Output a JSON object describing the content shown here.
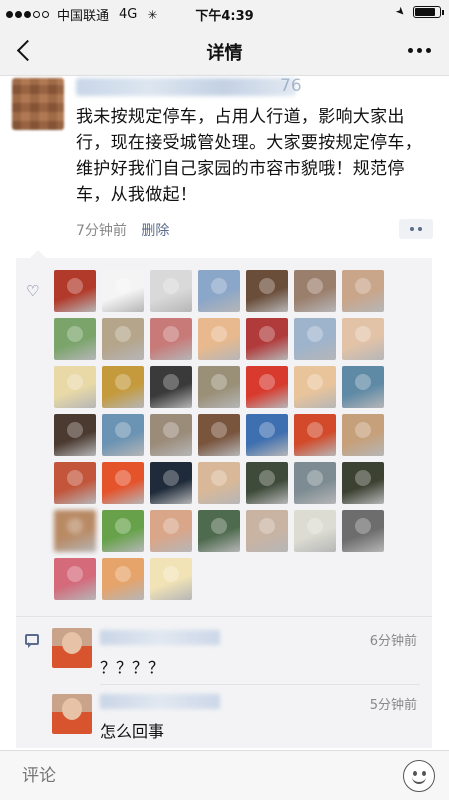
{
  "status_bar": {
    "carrier": "中国联通",
    "network": "4G",
    "time": "下午4:39",
    "signal_strength": 3,
    "battery_level": 0.85
  },
  "nav": {
    "title": "详情"
  },
  "post": {
    "name_suffix": "76",
    "text": "我未按规定停车，占用人行道，影响大家出行，现在接受城管处理。大家要按规定停车，维护好我们自己家园的市容市貌哦！规范停车，从我做起！",
    "time": "7分钟前",
    "delete_label": "删除"
  },
  "likes": {
    "avatar_colors": [
      "#b23a2a",
      "#f4f4f4",
      "#d9d9d9",
      "#8aa6c8",
      "#6b4e3a",
      "#9b7f6d",
      "#c9a58a",
      "#7aa46a",
      "#b5a58a",
      "#c77a78",
      "#e8b98e",
      "#b13b3b",
      "#9eb3cc",
      "#e2c3a7",
      "#e8d9a6",
      "#c49a3c",
      "#3a3a3a",
      "#9a9078",
      "#d83a2e",
      "#e9c49a",
      "#5f8aa6",
      "#4b3a30",
      "#6b93b3",
      "#9b8c7a",
      "#7a553e",
      "#3e6fb0",
      "#d24a2a",
      "#c6a07a",
      "#c2553a",
      "#e5532b",
      "#1f2b3a",
      "#d8b898",
      "#3f4b3a",
      "#7d8c92",
      "#3c4232",
      "#b88a64",
      "#67a24a",
      "#d9a68a",
      "#4f6b4f",
      "#c9b3a2",
      "#dcdcd2",
      "#6d6d6d",
      "#d46a7a",
      "#e6a36a",
      "#f1e3b6"
    ]
  },
  "comments": [
    {
      "time": "6分钟前",
      "text": "？？？？"
    },
    {
      "time": "5分钟前",
      "text": "怎么回事"
    }
  ],
  "input": {
    "placeholder": "评论"
  }
}
